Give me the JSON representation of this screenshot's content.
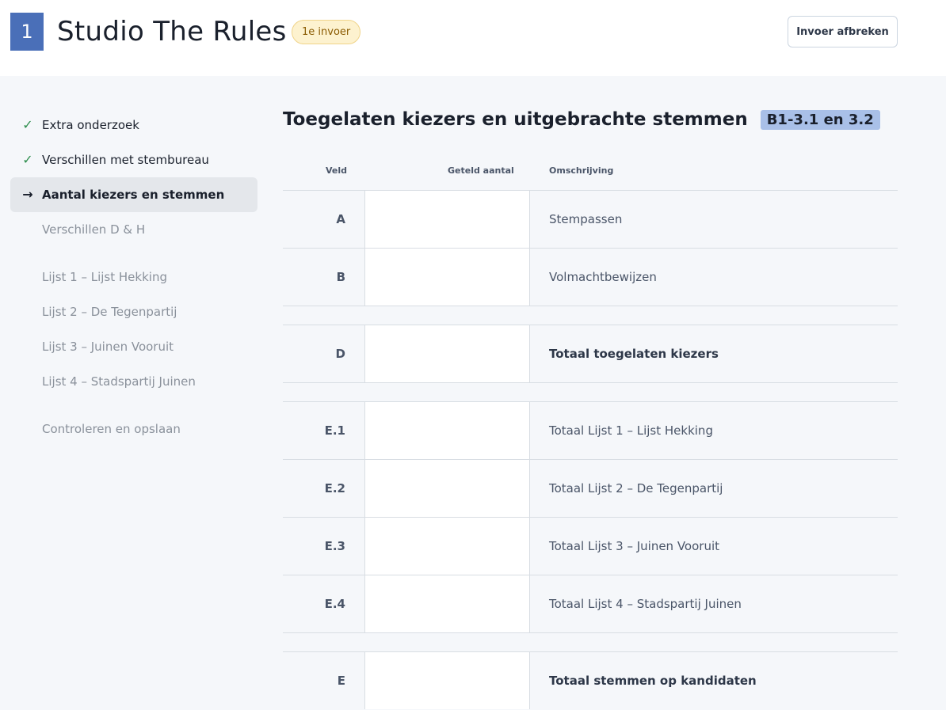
{
  "header": {
    "station_number": "1",
    "station_name": "Studio The Rules",
    "badge": "1e invoer",
    "abort_label": "Invoer afbreken"
  },
  "nav": {
    "items": [
      {
        "label": "Extra onderzoek",
        "state": "done"
      },
      {
        "label": "Verschillen met stembureau",
        "state": "done"
      },
      {
        "label": "Aantal kiezers en stemmen",
        "state": "active"
      },
      {
        "label": "Verschillen D & H",
        "state": "todo"
      },
      {
        "label": "Lijst 1 – Lijst Hekking",
        "state": "todo"
      },
      {
        "label": "Lijst 2 – De Tegenpartij",
        "state": "todo"
      },
      {
        "label": "Lijst 3 – Juinen Vooruit",
        "state": "todo"
      },
      {
        "label": "Lijst 4 – Stadspartij Juinen",
        "state": "todo"
      },
      {
        "label": "Controleren en opslaan",
        "state": "todo"
      }
    ],
    "check_icon": "✓",
    "arrow_icon": "→"
  },
  "form": {
    "title": "Toegelaten kiezers en uitgebrachte stemmen",
    "tag": "B1-3.1 en 3.2",
    "columns": {
      "field": "Veld",
      "count": "Geteld aantal",
      "description": "Omschrijving"
    },
    "rows": [
      {
        "code": "A",
        "description": "Stempassen",
        "value": ""
      },
      {
        "code": "B",
        "description": "Volmachtbewijzen",
        "value": ""
      },
      {
        "code": "D",
        "description": "Totaal toegelaten kiezers",
        "value": ""
      },
      {
        "code": "E.1",
        "description": "Totaal Lijst 1 – Lijst Hekking",
        "value": ""
      },
      {
        "code": "E.2",
        "description": "Totaal Lijst 2 – De Tegenpartij",
        "value": ""
      },
      {
        "code": "E.3",
        "description": "Totaal Lijst 3 – Juinen Vooruit",
        "value": ""
      },
      {
        "code": "E.4",
        "description": "Totaal Lijst 4 – Stadspartij Juinen",
        "value": ""
      },
      {
        "code": "E",
        "description": "Totaal stemmen op kandidaten",
        "value": ""
      }
    ]
  },
  "colors": {
    "accent": "#4a6fb8",
    "badge_bg": "#fdf2cf",
    "tag_bg": "#a9c0e8",
    "check": "#2f8f4e"
  }
}
